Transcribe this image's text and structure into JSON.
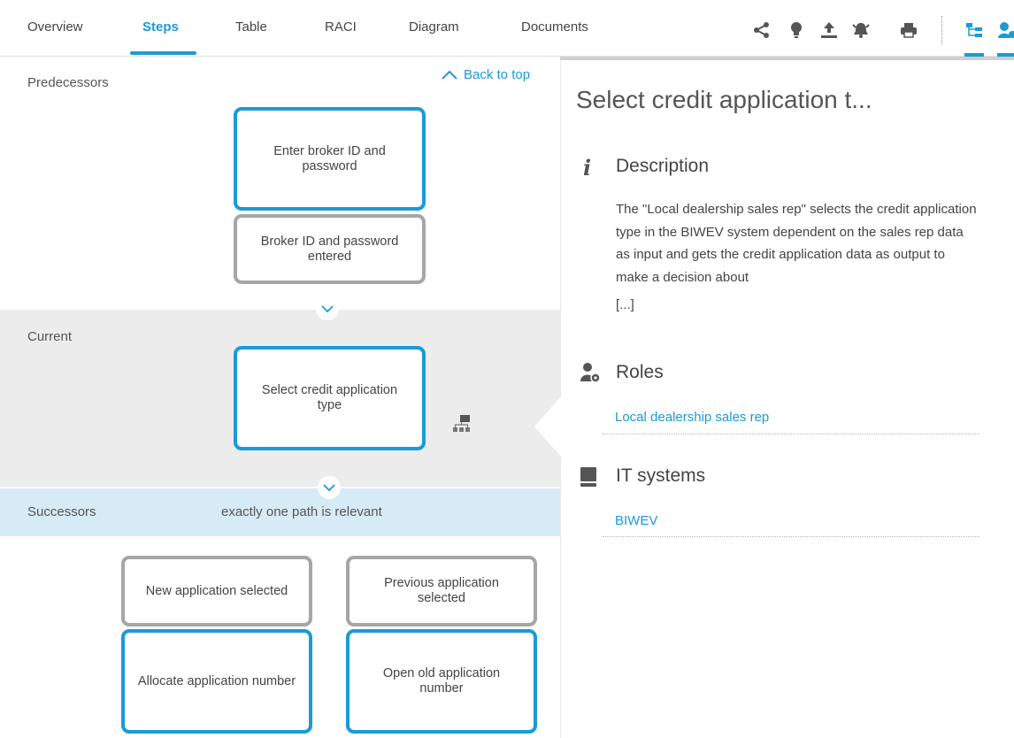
{
  "nav": {
    "tabs": [
      {
        "label": "Overview",
        "active": false
      },
      {
        "label": "Steps",
        "active": true
      },
      {
        "label": "Table",
        "active": false
      },
      {
        "label": "RACI",
        "active": false
      },
      {
        "label": "Diagram",
        "active": false
      },
      {
        "label": "Documents",
        "active": false
      }
    ],
    "tools": [
      "share-icon",
      "lightbulb-icon",
      "upload-icon",
      "alarm-icon",
      "print-icon",
      "tree-view-icon",
      "roles-view-icon"
    ],
    "accent_color": "#1a9bd7"
  },
  "steps": {
    "back_to_top": "Back to top",
    "predecessors_label": "Predecessors",
    "predecessor_function": "Enter broker ID and password",
    "predecessor_event": "Broker ID and password entered",
    "current_label": "Current",
    "current_function": "Select credit application type",
    "successors_label": "Successors",
    "successors_note": "exactly one path is relevant",
    "successor_events": [
      "New application selected",
      "Previous application selected"
    ],
    "successor_functions": [
      "Allocate application number",
      "Open old application number"
    ]
  },
  "detail": {
    "title": "Select credit application t...",
    "description_heading": "Description",
    "description_text": "The \"Local dealership sales rep\" selects the credit application type in the BIWEV system dependent on the sales rep data as input and gets the credit application data as output to make a decision about",
    "description_more": "[...]",
    "roles_heading": "Roles",
    "roles": [
      "Local dealership sales rep"
    ],
    "it_systems_heading": "IT systems",
    "it_systems": [
      "BIWEV"
    ]
  }
}
